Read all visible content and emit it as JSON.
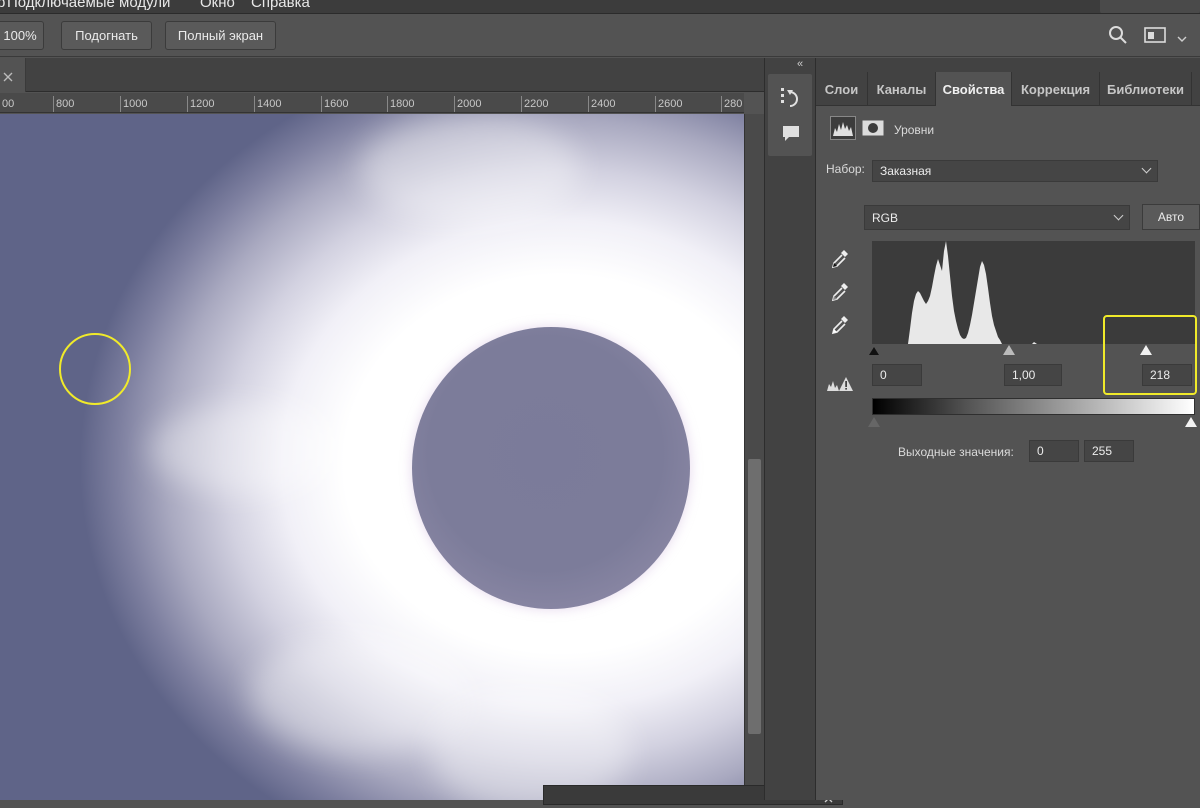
{
  "menubar": {
    "items": [
      "р",
      "Подключаемые модули",
      "Окно",
      "Справка"
    ]
  },
  "optionsbar": {
    "zoom_label": "100%",
    "fit_label": "Подогнать",
    "fullscreen_label": "Полный экран"
  },
  "ruler": {
    "labels": [
      "00",
      "800",
      "1000",
      "1200",
      "1400",
      "1600",
      "1800",
      "2000",
      "2200",
      "2400",
      "2600",
      "280"
    ]
  },
  "panel": {
    "tabs": [
      {
        "label": "Слои"
      },
      {
        "label": "Каналы"
      },
      {
        "label": "Свойства"
      },
      {
        "label": "Коррекция"
      },
      {
        "label": "Библиотеки"
      }
    ],
    "active_tab": "Свойства",
    "adjustment_name": "Уровни",
    "preset_label": "Набор:",
    "preset_value": "Заказная",
    "channel_value": "RGB",
    "auto_label": "Авто",
    "input_black": "0",
    "input_gamma": "1,00",
    "input_white": "218",
    "output_label": "Выходные значения:",
    "output_black": "0",
    "output_white": "255"
  },
  "colors": {
    "accent_highlight": "#f0ea2a",
    "ui_background": "#535353",
    "ui_dark": "#424242"
  },
  "icons": [
    "search-icon",
    "workspace-icon",
    "collapse-icon",
    "close-icon",
    "history-icon",
    "comment-icon",
    "histogram-icon",
    "mask-icon",
    "eyedropper-black-icon",
    "eyedropper-gray-icon",
    "eyedropper-white-icon",
    "clipping-warning-icon"
  ]
}
